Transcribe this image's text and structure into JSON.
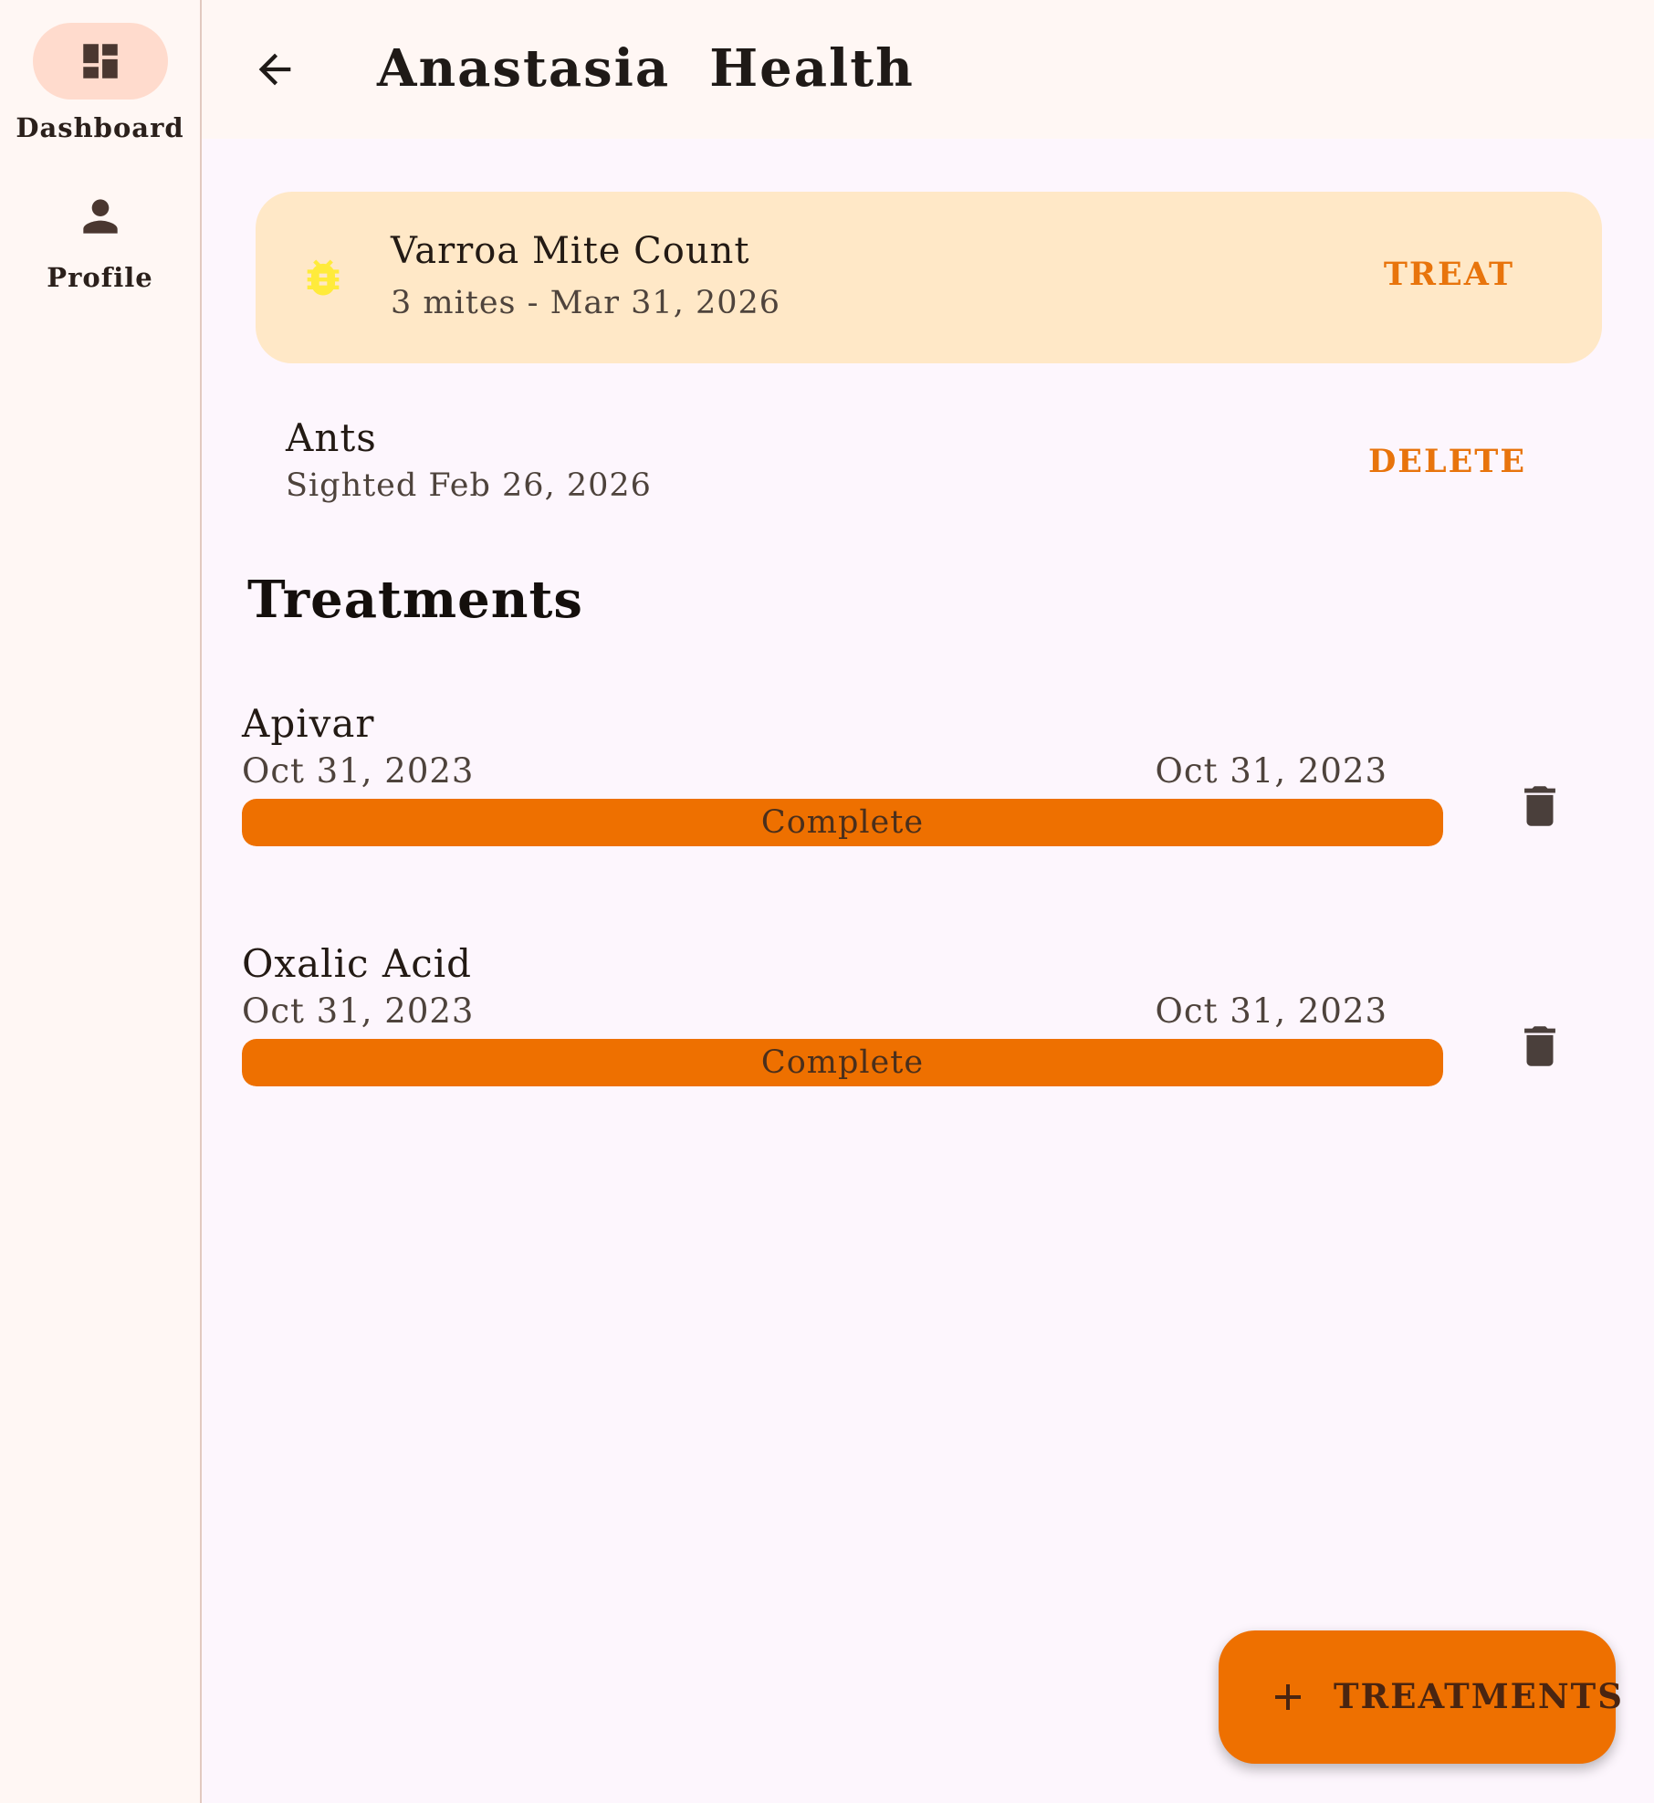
{
  "nav_rail": {
    "items": [
      {
        "label": "Dashboard",
        "icon": "dashboard-icon",
        "selected": true
      },
      {
        "label": "Profile",
        "icon": "person-icon",
        "selected": false
      }
    ]
  },
  "app_bar": {
    "back_icon": "arrow-back-icon",
    "title": "Anastasia  Health"
  },
  "alert_card": {
    "icon": "bug-icon",
    "title": "Varroa Mite Count",
    "subtitle": "3 mites - Mar 31, 2026",
    "action_label": "TREAT"
  },
  "sighting": {
    "title": "Ants",
    "subtitle": "Sighted Feb 26, 2026",
    "action_label": "DELETE"
  },
  "treatments": {
    "heading": "Treatments",
    "items": [
      {
        "name": "Apivar",
        "start": "Oct 31, 2023",
        "end": "Oct 31, 2023",
        "status": "Complete",
        "progress": 1.0
      },
      {
        "name": "Oxalic Acid",
        "start": "Oct 31, 2023",
        "end": "Oct 31, 2023",
        "status": "Complete",
        "progress": 1.0
      }
    ]
  },
  "fab": {
    "icon": "plus-icon",
    "label": "TREATMENTS"
  },
  "colors": {
    "accent": "#ee7000",
    "alert_bg": "#ffe8c7",
    "bug_icon": "#ffeb3b",
    "rail_selected": "#ffdbcd"
  }
}
